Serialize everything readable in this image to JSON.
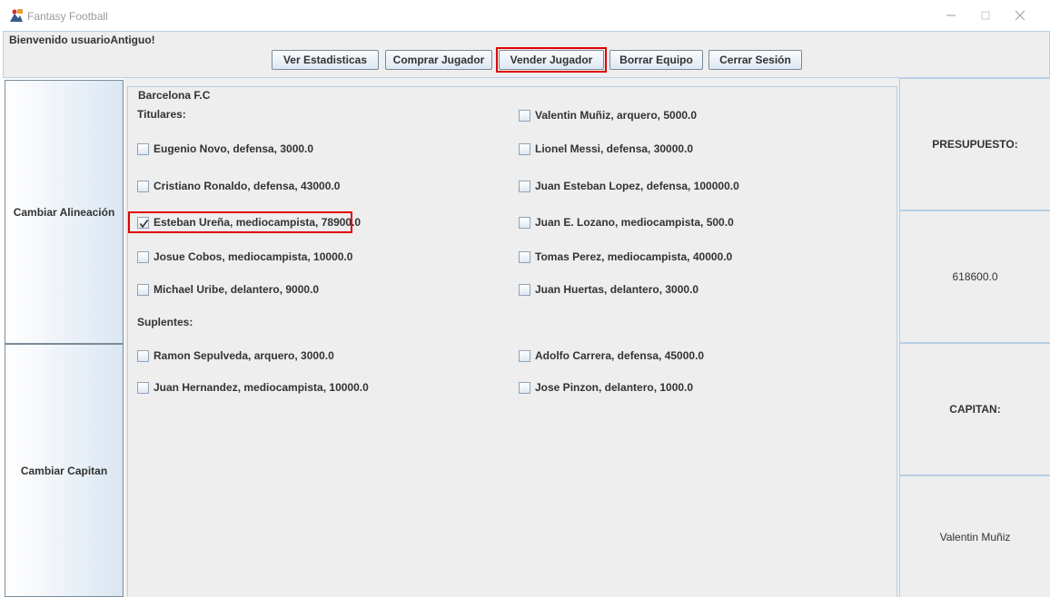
{
  "window": {
    "title": "Fantasy Football"
  },
  "header": {
    "welcome": "Bienvenido usuarioAntiguo!",
    "buttons": {
      "ver_estadisticas": "Ver Estadisticas",
      "comprar_jugador": "Comprar Jugador",
      "vender_jugador": "Vender Jugador",
      "borrar_equipo": "Borrar Equipo",
      "cerrar_sesion": "Cerrar Sesión"
    }
  },
  "sidebar": {
    "cambiar_alineacion": "Cambiar Alineación",
    "cambiar_capitan": "Cambiar Capitan"
  },
  "team": {
    "name": "Barcelona F.C",
    "titulares_label": "Titulares:",
    "suplentes_label": "Suplentes:",
    "titulares": [
      {
        "label": "Valentin Muñiz, arquero, 5000.0",
        "checked": false
      },
      {
        "label": "Eugenio Novo, defensa, 3000.0",
        "checked": false
      },
      {
        "label": "Lionel Messi, defensa, 30000.0",
        "checked": false
      },
      {
        "label": "Cristiano Ronaldo, defensa, 43000.0",
        "checked": false
      },
      {
        "label": "Juan Esteban Lopez, defensa, 100000.0",
        "checked": false
      },
      {
        "label": "Esteban Ureña, mediocampista, 78900.0",
        "checked": true
      },
      {
        "label": "Juan E. Lozano, mediocampista, 500.0",
        "checked": false
      },
      {
        "label": "Josue Cobos, mediocampista, 10000.0",
        "checked": false
      },
      {
        "label": "Tomas Perez, mediocampista, 40000.0",
        "checked": false
      },
      {
        "label": "Michael Uribe, delantero, 9000.0",
        "checked": false
      },
      {
        "label": "Juan Huertas, delantero, 3000.0",
        "checked": false
      }
    ],
    "suplentes": [
      {
        "label": "Ramon Sepulveda, arquero, 3000.0",
        "checked": false
      },
      {
        "label": "Adolfo Carrera, defensa, 45000.0",
        "checked": false
      },
      {
        "label": "Juan Hernandez, mediocampista, 10000.0",
        "checked": false
      },
      {
        "label": "Jose Pinzon, delantero, 1000.0",
        "checked": false
      }
    ]
  },
  "info": {
    "presupuesto_label": "PRESUPUESTO:",
    "presupuesto_value": "618600.0",
    "capitan_label": "CAPITAN:",
    "capitan_value": "Valentin Muñiz"
  },
  "colors": {
    "highlight": "#e00000",
    "panel_border": "#b8cfe5",
    "panel_bg": "#eeeeee"
  }
}
